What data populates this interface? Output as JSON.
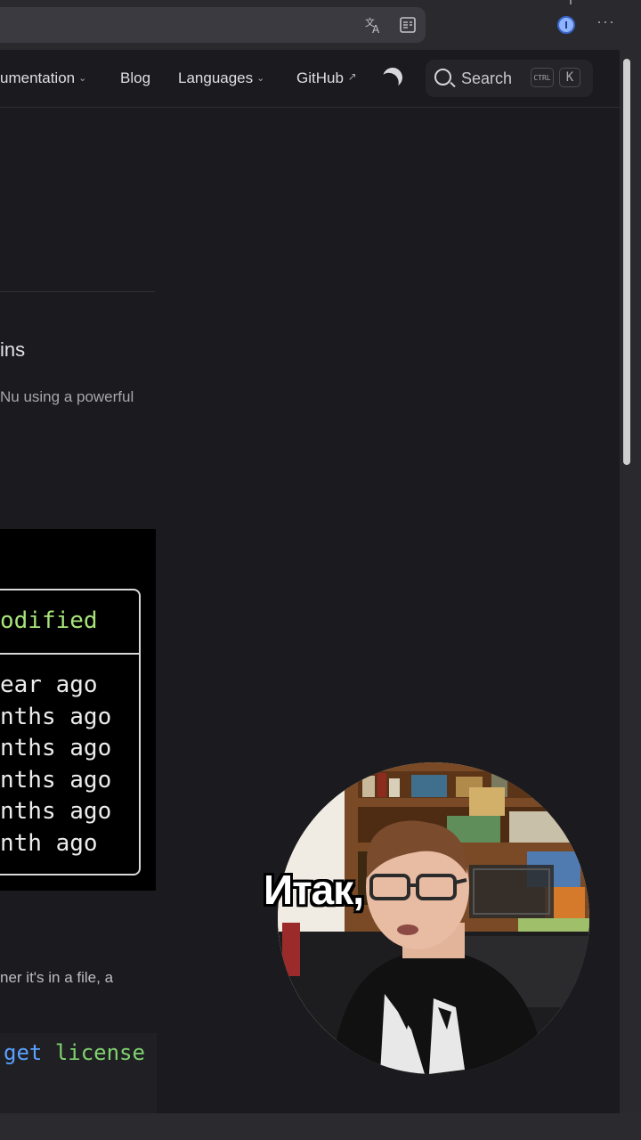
{
  "browser": {
    "translate_icon": "translate-icon",
    "reader_icon": "reader-view-icon",
    "extension_icon": "password-manager-icon",
    "menu_icon": "more-options-icon"
  },
  "nav": {
    "documentation_label": "umentation",
    "blog_label": "Blog",
    "languages_label": "Languages",
    "github_label": "GitHub",
    "github_suffix": "↗",
    "search_label": "Search",
    "shortcut_ctrl": "CTRL",
    "shortcut_key": "K"
  },
  "content": {
    "heading_fragment": "ins",
    "paragraph_fragment": "Nu using a powerful",
    "terminal": {
      "header": "odified",
      "rows": [
        "ear ago",
        "nths ago",
        "nths ago",
        "nths ago",
        "nths ago",
        "nth ago"
      ]
    },
    "paragraph2_fragment": "ner it's in a file, a",
    "code": {
      "word1": "get",
      "word2": "license"
    }
  },
  "overlay": {
    "caption": "Итак,"
  },
  "colors": {
    "page_bg": "#1b1b1f",
    "terminal_header": "#a6e37a",
    "code_keyword": "#5aa0ff",
    "code_string": "#7fd26e"
  }
}
